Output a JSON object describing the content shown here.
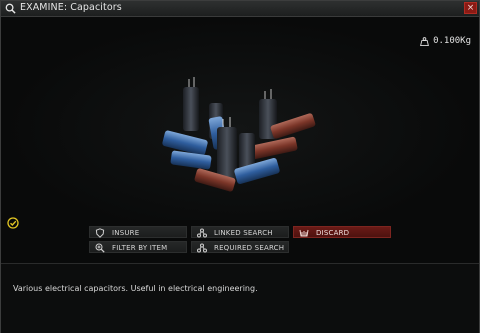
{
  "window": {
    "title": "EXAMINE: Capacitors",
    "close_label": "×"
  },
  "item": {
    "weight": "0.100Kg",
    "description": "Various electrical capacitors. Useful in electrical engineering."
  },
  "actions": {
    "insure": "INSURE",
    "linked_search": "LINKED SEARCH",
    "discard": "DISCARD",
    "filter_by_item": "FILTER BY ITEM",
    "required_search": "REQUIRED SEARCH"
  },
  "colors": {
    "discard_bg": "#6a1a16",
    "check_accent": "#e2c623",
    "close_bg": "#8b1a14"
  },
  "icons": [
    "search-icon",
    "weight-icon",
    "checkmark-icon",
    "shield-icon",
    "link-icon",
    "discard-icon",
    "zoom-icon",
    "tree-icon"
  ]
}
